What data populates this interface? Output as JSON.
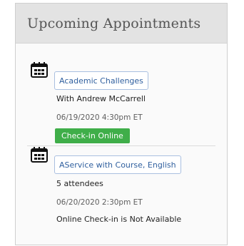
{
  "widget": {
    "title": "Upcoming Appointments"
  },
  "appointments": [
    {
      "title": "Academic Challenges",
      "detail": "With Andrew McCarrell",
      "datetime": "06/19/2020 4:30pm ET",
      "checkin_label": "Check-in Online"
    },
    {
      "title": "AService with Course, English",
      "detail": "5 attendees",
      "datetime": "06/20/2020 2:30pm ET",
      "status": "Online Check-in is Not Available"
    }
  ],
  "icons": {
    "calendar": "calendar-icon"
  },
  "colors": {
    "header_bg": "#e3e3e3",
    "link_border": "#a9bfe0",
    "link_text": "#2f5f9e",
    "checkin_button": "#3fae49"
  }
}
